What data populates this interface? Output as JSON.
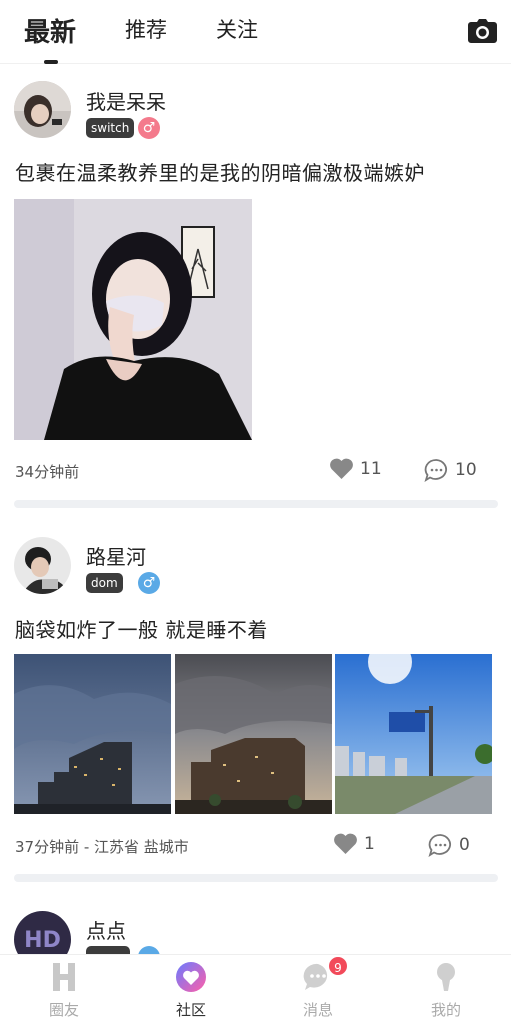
{
  "tabs": [
    {
      "label": "最新",
      "active": true
    },
    {
      "label": "推荐",
      "active": false
    },
    {
      "label": "关注",
      "active": false
    }
  ],
  "posts": [
    {
      "username": "我是呆呆",
      "tag": "switch",
      "gender": "female",
      "gender_symbol": "♂",
      "content": "包裹在温柔教养里的是我的阴暗偏激极端嫉妒",
      "time": "34分钟前",
      "likes": "11",
      "comments": "10"
    },
    {
      "username": "路星河",
      "tag": "dom",
      "gender": "male",
      "gender_symbol": "♂",
      "content": "脑袋如炸了一般  就是睡不着",
      "time": "37分钟前 - 江苏省 盐城市",
      "likes": "1",
      "comments": "0"
    },
    {
      "username": "点点",
      "tag": "",
      "gender": "male"
    }
  ],
  "nav": [
    {
      "label": "圈友",
      "icon": "h-logo-icon"
    },
    {
      "label": "社区",
      "icon": "community-heart-icon",
      "active": true
    },
    {
      "label": "消息",
      "icon": "message-icon",
      "badge": "9"
    },
    {
      "label": "我的",
      "icon": "profile-icon"
    }
  ],
  "colors": {
    "female": "#f47a8c",
    "male": "#5aa9e6",
    "badge": "#f24a5a",
    "accent_gradient": [
      "#6a7bff",
      "#ff5fa8"
    ]
  }
}
